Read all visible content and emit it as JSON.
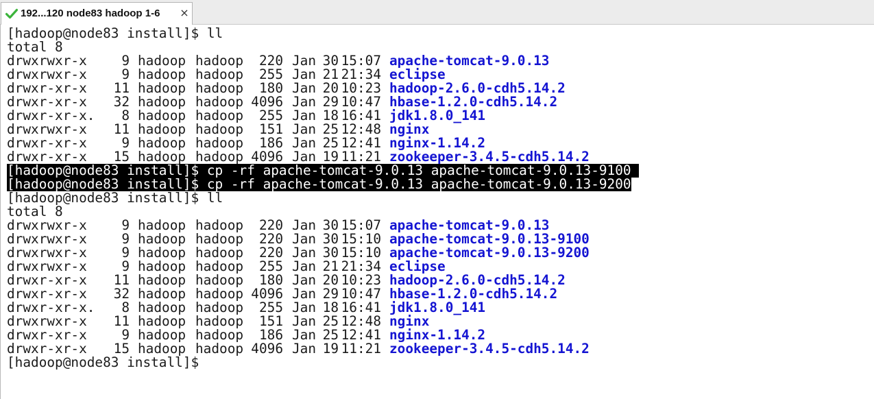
{
  "tab": {
    "title": "192...120 node83 hadoop 1-6",
    "close_label": "×",
    "status_icon": "check-icon",
    "status_color": "#3cb43c"
  },
  "colors": {
    "directory_name": "#1414d2",
    "highlight_bg": "#000000",
    "highlight_fg": "#ffffff"
  },
  "terminal": {
    "lines": [
      {
        "type": "text",
        "text": "[hadoop@node83 install]$ ll"
      },
      {
        "type": "text",
        "text": "total 8"
      },
      {
        "type": "entry",
        "perm": "drwxrwxr-x",
        "links": "9",
        "owner": "hadoop",
        "group": "hadoop",
        "size": "220",
        "month": "Jan",
        "day": "30",
        "time": "15:07",
        "name": "apache-tomcat-9.0.13"
      },
      {
        "type": "entry",
        "perm": "drwxrwxr-x",
        "links": "9",
        "owner": "hadoop",
        "group": "hadoop",
        "size": "255",
        "month": "Jan",
        "day": "21",
        "time": "21:34",
        "name": "eclipse"
      },
      {
        "type": "entry",
        "perm": "drwxr-xr-x",
        "links": "11",
        "owner": "hadoop",
        "group": "hadoop",
        "size": "180",
        "month": "Jan",
        "day": "20",
        "time": "10:23",
        "name": "hadoop-2.6.0-cdh5.14.2"
      },
      {
        "type": "entry",
        "perm": "drwxr-xr-x",
        "links": "32",
        "owner": "hadoop",
        "group": "hadoop",
        "size": "4096",
        "month": "Jan",
        "day": "29",
        "time": "10:47",
        "name": "hbase-1.2.0-cdh5.14.2"
      },
      {
        "type": "entry",
        "perm": "drwxr-xr-x.",
        "links": "8",
        "owner": "hadoop",
        "group": "hadoop",
        "size": "255",
        "month": "Jan",
        "day": "18",
        "time": "16:41",
        "name": "jdk1.8.0_141"
      },
      {
        "type": "entry",
        "perm": "drwxrwxr-x",
        "links": "11",
        "owner": "hadoop",
        "group": "hadoop",
        "size": "151",
        "month": "Jan",
        "day": "25",
        "time": "12:48",
        "name": "nginx"
      },
      {
        "type": "entry",
        "perm": "drwxr-xr-x",
        "links": "9",
        "owner": "hadoop",
        "group": "hadoop",
        "size": "186",
        "month": "Jan",
        "day": "25",
        "time": "12:41",
        "name": "nginx-1.14.2"
      },
      {
        "type": "entry",
        "perm": "drwxr-xr-x",
        "links": "15",
        "owner": "hadoop",
        "group": "hadoop",
        "size": "4096",
        "month": "Jan",
        "day": "19",
        "time": "11:21",
        "name": "zookeeper-3.4.5-cdh5.14.2"
      },
      {
        "type": "text",
        "highlight": true,
        "text": "[hadoop@node83 install]$ cp -rf apache-tomcat-9.0.13 apache-tomcat-9.0.13-9100 "
      },
      {
        "type": "text",
        "highlight": true,
        "text": "[hadoop@node83 install]$ cp -rf apache-tomcat-9.0.13 apache-tomcat-9.0.13-9200"
      },
      {
        "type": "text",
        "text": "[hadoop@node83 install]$ ll"
      },
      {
        "type": "text",
        "text": "total 8"
      },
      {
        "type": "entry",
        "perm": "drwxrwxr-x",
        "links": "9",
        "owner": "hadoop",
        "group": "hadoop",
        "size": "220",
        "month": "Jan",
        "day": "30",
        "time": "15:07",
        "name": "apache-tomcat-9.0.13"
      },
      {
        "type": "entry",
        "perm": "drwxrwxr-x",
        "links": "9",
        "owner": "hadoop",
        "group": "hadoop",
        "size": "220",
        "month": "Jan",
        "day": "30",
        "time": "15:10",
        "name": "apache-tomcat-9.0.13-9100"
      },
      {
        "type": "entry",
        "perm": "drwxrwxr-x",
        "links": "9",
        "owner": "hadoop",
        "group": "hadoop",
        "size": "220",
        "month": "Jan",
        "day": "30",
        "time": "15:10",
        "name": "apache-tomcat-9.0.13-9200"
      },
      {
        "type": "entry",
        "perm": "drwxrwxr-x",
        "links": "9",
        "owner": "hadoop",
        "group": "hadoop",
        "size": "255",
        "month": "Jan",
        "day": "21",
        "time": "21:34",
        "name": "eclipse"
      },
      {
        "type": "entry",
        "perm": "drwxr-xr-x",
        "links": "11",
        "owner": "hadoop",
        "group": "hadoop",
        "size": "180",
        "month": "Jan",
        "day": "20",
        "time": "10:23",
        "name": "hadoop-2.6.0-cdh5.14.2"
      },
      {
        "type": "entry",
        "perm": "drwxr-xr-x",
        "links": "32",
        "owner": "hadoop",
        "group": "hadoop",
        "size": "4096",
        "month": "Jan",
        "day": "29",
        "time": "10:47",
        "name": "hbase-1.2.0-cdh5.14.2"
      },
      {
        "type": "entry",
        "perm": "drwxr-xr-x.",
        "links": "8",
        "owner": "hadoop",
        "group": "hadoop",
        "size": "255",
        "month": "Jan",
        "day": "18",
        "time": "16:41",
        "name": "jdk1.8.0_141"
      },
      {
        "type": "entry",
        "perm": "drwxrwxr-x",
        "links": "11",
        "owner": "hadoop",
        "group": "hadoop",
        "size": "151",
        "month": "Jan",
        "day": "25",
        "time": "12:48",
        "name": "nginx"
      },
      {
        "type": "entry",
        "perm": "drwxr-xr-x",
        "links": "9",
        "owner": "hadoop",
        "group": "hadoop",
        "size": "186",
        "month": "Jan",
        "day": "25",
        "time": "12:41",
        "name": "nginx-1.14.2"
      },
      {
        "type": "entry",
        "perm": "drwxr-xr-x",
        "links": "15",
        "owner": "hadoop",
        "group": "hadoop",
        "size": "4096",
        "month": "Jan",
        "day": "19",
        "time": "11:21",
        "name": "zookeeper-3.4.5-cdh5.14.2"
      },
      {
        "type": "text",
        "text": "[hadoop@node83 install]$"
      }
    ]
  }
}
